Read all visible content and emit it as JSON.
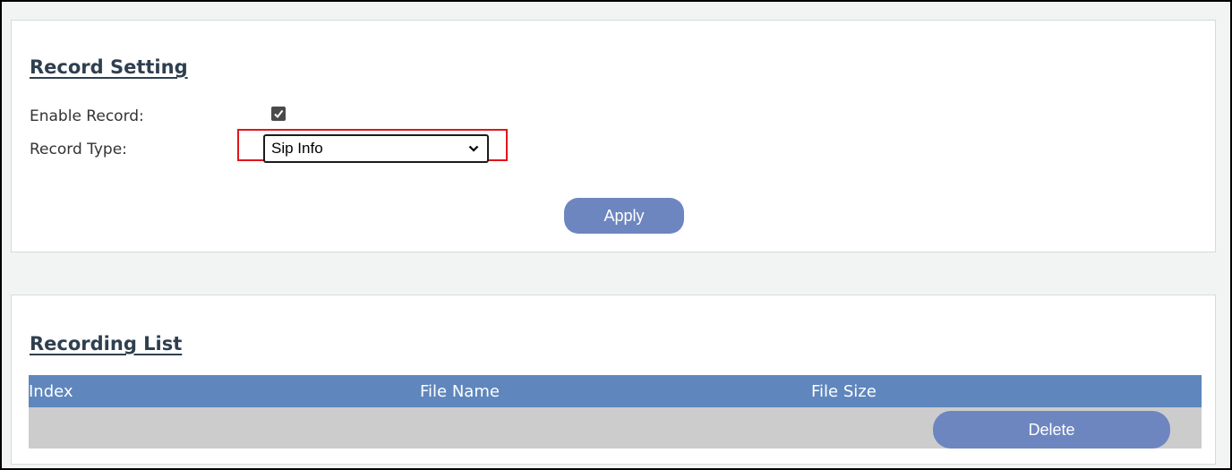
{
  "record_setting": {
    "title": "Record Setting",
    "enable_label": "Enable Record:",
    "enable_checked": true,
    "type_label": "Record Type:",
    "type_value": "Sip Info",
    "apply_label": "Apply"
  },
  "recording_list": {
    "title": "Recording List",
    "columns": [
      "Index",
      "File Name",
      "File Size"
    ],
    "delete_label": "Delete"
  },
  "colors": {
    "button": "#6d86c0",
    "table_header": "#5f86bd",
    "highlight": "#e3141b"
  },
  "icons": {
    "checkbox": "checkmark-icon",
    "select": "chevron-down-icon"
  }
}
